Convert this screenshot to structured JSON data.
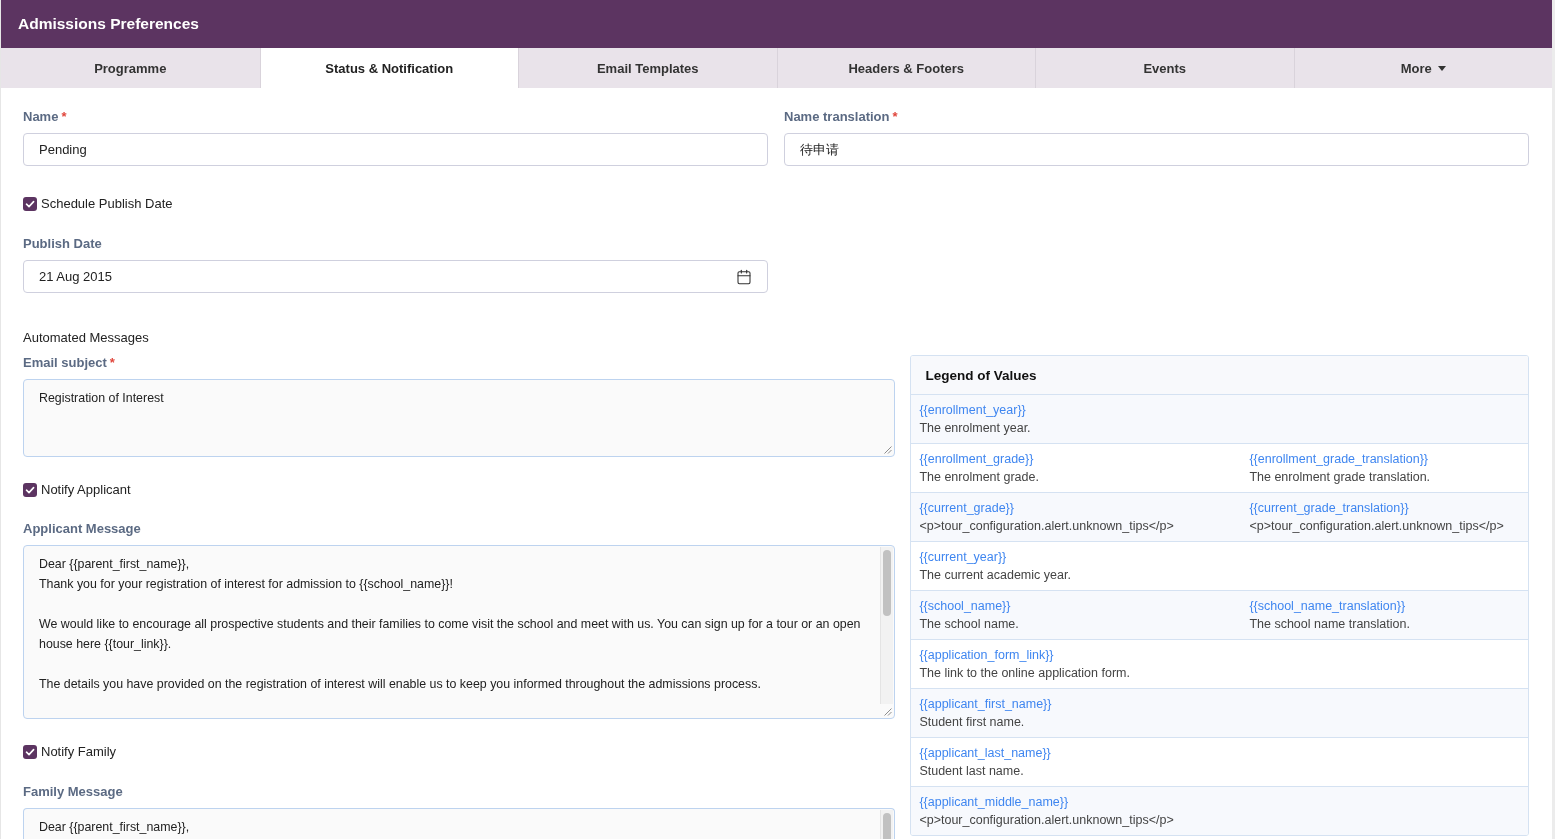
{
  "header": {
    "title": "Admissions Preferences"
  },
  "tabs": [
    {
      "label": "Programme",
      "selected": false,
      "kind": "tab"
    },
    {
      "label": "Status & Notification",
      "selected": true,
      "kind": "tab"
    },
    {
      "label": "Email Templates",
      "selected": false,
      "kind": "tab"
    },
    {
      "label": "Headers & Footers",
      "selected": false,
      "kind": "tab"
    },
    {
      "label": "Events",
      "selected": false,
      "kind": "tab"
    },
    {
      "label": "More",
      "selected": false,
      "kind": "dropdown"
    }
  ],
  "form": {
    "name": {
      "label": "Name",
      "required_mark": "*",
      "value": "Pending"
    },
    "name_translation": {
      "label": "Name translation",
      "required_mark": "*",
      "value": "待申请"
    },
    "schedule_publish_date": {
      "label": "Schedule Publish Date",
      "checked": true
    },
    "publish_date": {
      "label": "Publish Date",
      "value": "21 Aug 2015"
    }
  },
  "automated_messages": {
    "heading": "Automated Messages",
    "email_subject": {
      "label": "Email subject",
      "required_mark": "*",
      "value": "Registration of Interest"
    },
    "notify_applicant": {
      "label": "Notify Applicant",
      "checked": true
    },
    "applicant_message": {
      "label": "Applicant Message",
      "value": "Dear {{parent_first_name}},\nThank you for your registration of interest for admission to {{school_name}}!\n\nWe would like to encourage all prospective students and their families to come visit the school and meet with us. You can sign up for a tour or an open house here {{tour_link}}.\n\nThe details you have provided on the registration of interest will enable us to keep you informed throughout the admissions process."
    },
    "notify_family": {
      "label": "Notify Family",
      "checked": true
    },
    "family_message": {
      "label": "Family Message",
      "value": "Dear {{parent_first_name}},"
    }
  },
  "legend": {
    "title": "Legend of Values",
    "rows": [
      {
        "cells": [
          {
            "variable": "{{enrollment_year}}",
            "description": "The enrolment year."
          }
        ]
      },
      {
        "cells": [
          {
            "variable": "{{enrollment_grade}}",
            "description": "The enrolment grade."
          },
          {
            "variable": "{{enrollment_grade_translation}}",
            "description": "The enrolment grade translation."
          }
        ]
      },
      {
        "cells": [
          {
            "variable": "{{current_grade}}",
            "description": "<p>tour_configuration.alert.unknown_tips</p>"
          },
          {
            "variable": "{{current_grade_translation}}",
            "description": "<p>tour_configuration.alert.unknown_tips</p>"
          }
        ]
      },
      {
        "cells": [
          {
            "variable": "{{current_year}}",
            "description": "The current academic year."
          }
        ]
      },
      {
        "cells": [
          {
            "variable": "{{school_name}}",
            "description": "The school name."
          },
          {
            "variable": "{{school_name_translation}}",
            "description": "The school name translation."
          }
        ]
      },
      {
        "cells": [
          {
            "variable": "{{application_form_link}}",
            "description": "The link to the online application form."
          }
        ]
      },
      {
        "cells": [
          {
            "variable": "{{applicant_first_name}}",
            "description": "Student first name."
          }
        ]
      },
      {
        "cells": [
          {
            "variable": "{{applicant_last_name}}",
            "description": "Student last name."
          }
        ]
      },
      {
        "cells": [
          {
            "variable": "{{applicant_middle_name}}",
            "description": "<p>tour_configuration.alert.unknown_tips</p>"
          }
        ]
      }
    ]
  }
}
